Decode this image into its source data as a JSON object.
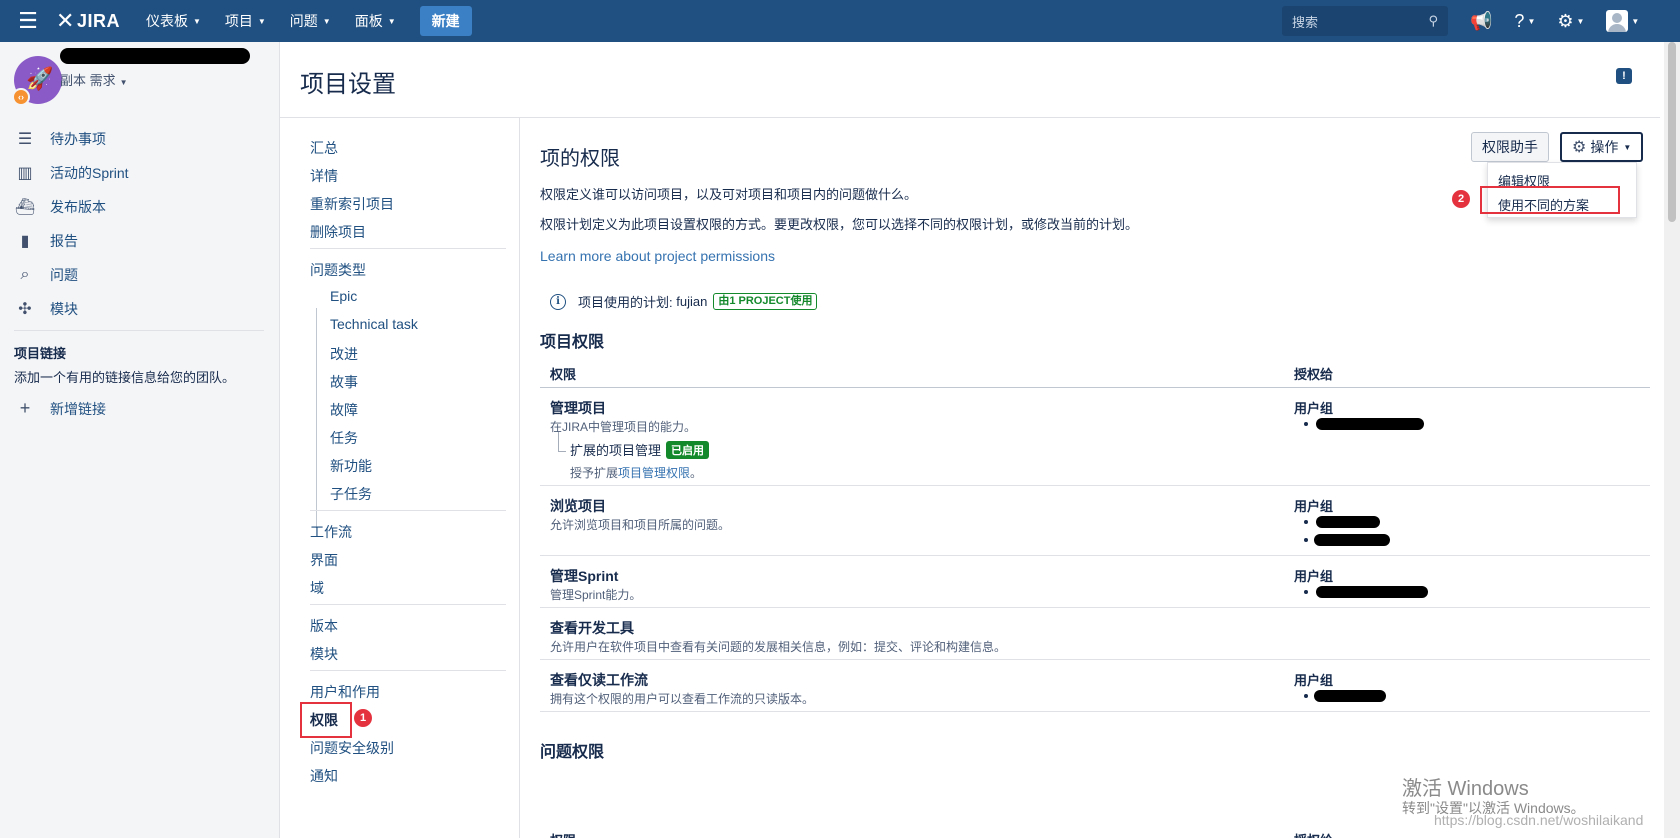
{
  "topnav": {
    "logo": "JIRA",
    "items": [
      "仪表板",
      "项目",
      "问题",
      "面板"
    ],
    "create": "新建",
    "search_placeholder": "搜索"
  },
  "sidebar": {
    "project_sub": "副本 需求",
    "items": [
      {
        "label": "待办事项",
        "icon": "backlog-icon"
      },
      {
        "label": "活动的Sprint",
        "icon": "board-icon"
      },
      {
        "label": "发布版本",
        "icon": "release-icon"
      },
      {
        "label": "报告",
        "icon": "chart-icon"
      },
      {
        "label": "问题",
        "icon": "search-issues-icon"
      },
      {
        "label": "模块",
        "icon": "puzzle-icon"
      }
    ],
    "links_title": "项目链接",
    "links_desc": "添加一个有用的链接信息给您的团队。",
    "add_link": "新增链接"
  },
  "page": {
    "title": "项目设置"
  },
  "settings_nav": {
    "items": [
      "汇总",
      "详情",
      "重新索引项目",
      "删除项目"
    ],
    "issue_types": "问题类型",
    "issue_type_items": [
      "Epic",
      "Technical task",
      "改进",
      "故事",
      "故障",
      "任务",
      "新功能",
      "子任务"
    ],
    "group2": [
      "工作流",
      "界面",
      "域"
    ],
    "group3": [
      "版本",
      "模块"
    ],
    "group4": [
      "用户和作用",
      "权限",
      "问题安全级别",
      "通知"
    ]
  },
  "markers": {
    "one": "1",
    "two": "2"
  },
  "content": {
    "title": "项的权限",
    "desc1": "权限定义谁可以访问项目，以及可对项目和项目内的问题做什么。",
    "desc2": "权限计划定义为此项目设置权限的方式。要更改权限，您可以选择不同的权限计划，或修改当前的计划。",
    "learn_more": "Learn more about project permissions",
    "scheme_label": "项目使用的计划:",
    "scheme_name": "fujian",
    "scheme_usage": "由1 PROJECT使用",
    "btn_assist": "权限助手",
    "btn_actions": "操作",
    "dropdown": [
      "编辑权限",
      "使用不同的方案"
    ],
    "section_project": "项目权限",
    "col_permission": "权限",
    "col_granted": "授权给",
    "rows": [
      {
        "name": "管理项目",
        "desc": "在JIRA中管理项目的能力。",
        "grant": "用户组"
      },
      {
        "name": "浏览项目",
        "desc": "允许浏览项目和项目所属的问题。",
        "grant": "用户组"
      },
      {
        "name": "管理Sprint",
        "desc": "管理Sprint能力。",
        "grant": "用户组"
      },
      {
        "name": "查看开发工具",
        "desc": "允许用户在软件项目中查看有关问题的发展相关信息，例如：提交、评论和构建信息。",
        "grant": ""
      },
      {
        "name": "查看仅读工作流",
        "desc": "拥有这个权限的用户可以查看工作流的只读版本。",
        "grant": "用户组"
      }
    ],
    "ext_name": "扩展的项目管理",
    "ext_badge": "已启用",
    "ext_desc_prefix": "授予扩展",
    "ext_desc_link": "项目管理权限",
    "ext_desc_suffix": "。",
    "section_issue": "问题权限",
    "bottom_col1": "权限",
    "bottom_col2": "授权给"
  },
  "watermark": {
    "line1": "激活 Windows",
    "line2": "转到\"设置\"以激活 Windows。",
    "csdn": "https://blog.csdn.net/woshilaikand"
  }
}
